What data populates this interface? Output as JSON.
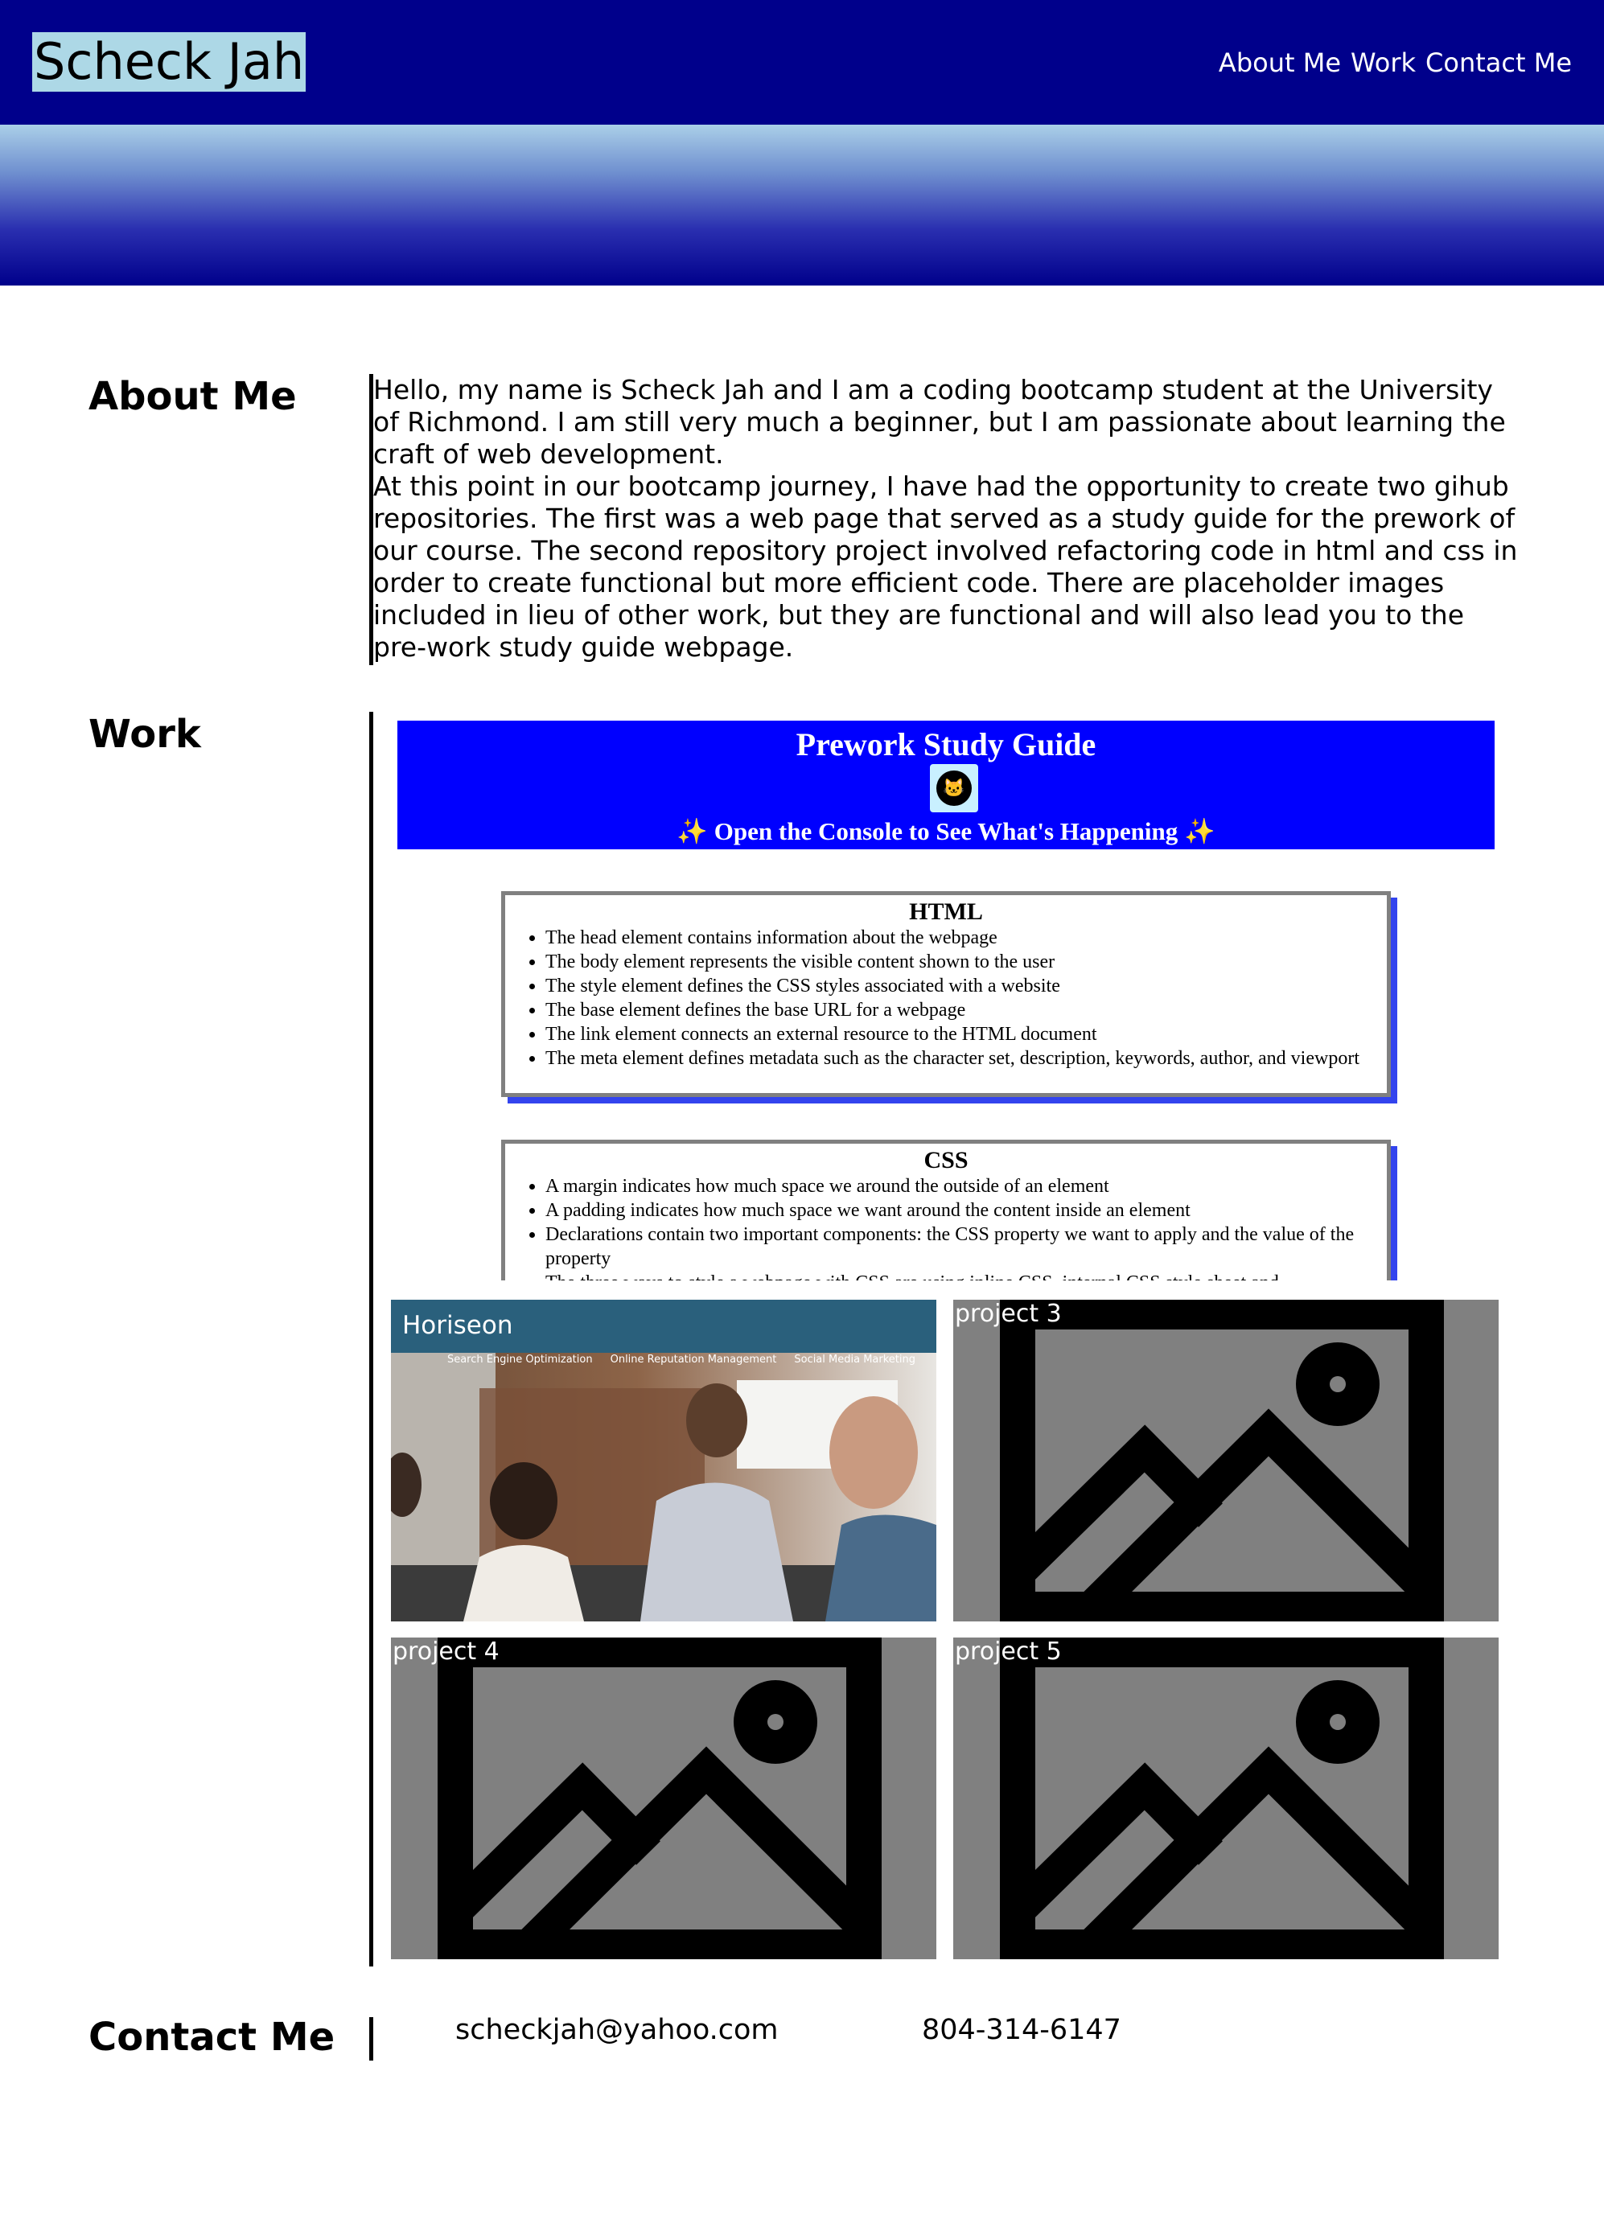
{
  "header": {
    "logo": "Scheck Jah",
    "nav": [
      "About Me",
      "Work",
      "Contact Me"
    ]
  },
  "about": {
    "title": "About Me",
    "paragraphs": [
      "Hello, my name is Scheck Jah and I am a coding bootcamp student at the University of Richmond. I am still very much a beginner, but I am passionate about learning the craft of web development.",
      "At this point in our bootcamp journey, I have had the opportunity to create two gihub repositories. The first was a web page that served as a study guide for the prework of our course. The second repository project involved refactoring code in html and css in order to create functional but more efficient code. There are placeholder images included in lieu of other work, but they are functional and will also lead you to the pre-work study guide webpage."
    ]
  },
  "work": {
    "title": "Work",
    "study_guide": {
      "title": "Prework Study Guide",
      "subtitle": "✨ Open the Console to See What's Happening ✨",
      "html_card": {
        "title": "HTML",
        "items": [
          "The head element contains information about the webpage",
          "The body element represents the visible content shown to the user",
          "The style element defines the CSS styles associated with a website",
          "The base element defines the base URL for a webpage",
          "The link element connects an external resource to the HTML document",
          "The meta element defines metadata such as the character set, description, keywords, author, and viewport"
        ]
      },
      "css_card": {
        "title": "CSS",
        "items": [
          "A margin indicates how much space we around the outside of an element",
          "A padding indicates how much space we want around the content inside an element",
          "Declarations contain two important components: the CSS property we want to apply and the value of the property",
          "The three ways to style a webpage with CSS are using inline CSS, internal CSS style sheet and"
        ]
      }
    },
    "horiseon": {
      "brand": "Horiseon",
      "links": [
        "Search Engine Optimization",
        "Online Reputation Management",
        "Social Media Marketing"
      ]
    },
    "projects": [
      "project 3",
      "project 4",
      "project 5"
    ]
  },
  "contact": {
    "title": "Contact Me",
    "email": "scheckjah@yahoo.com",
    "phone": "804-314-6147"
  },
  "colors": {
    "header_bg": "#00008b",
    "logo_bg": "#add8e6",
    "guide_banner": "#0000ff",
    "horiseon_bar": "#2a607c",
    "placeholder_bg": "#808080"
  }
}
